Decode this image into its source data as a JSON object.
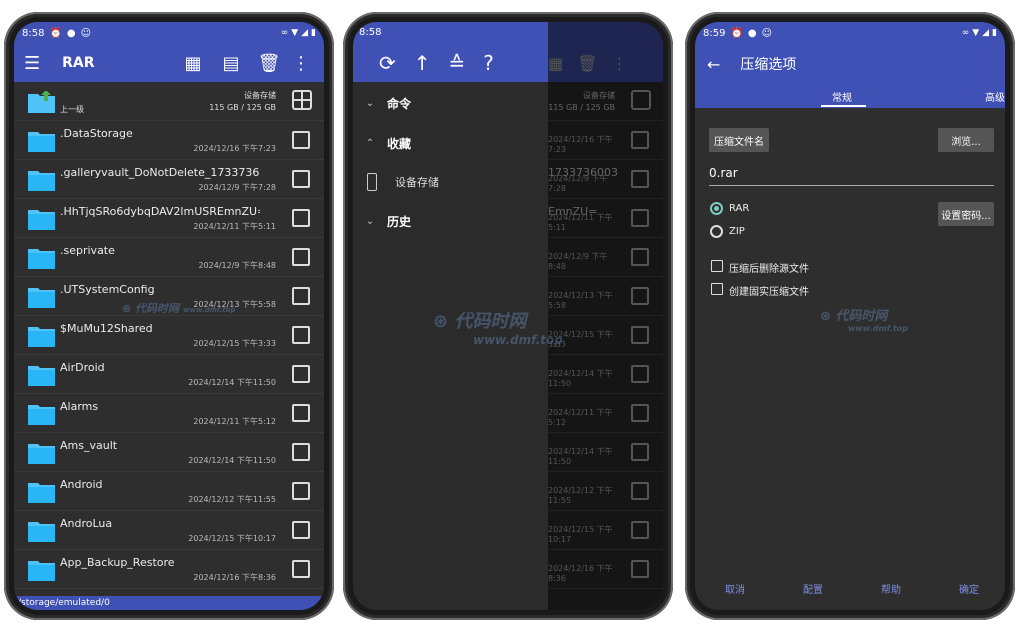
{
  "phone1": {
    "status": {
      "time": "8:58"
    },
    "toolbar": {
      "title": "RAR"
    },
    "up_row": {
      "label": "上一级",
      "storage_title": "设备存储",
      "storage_size": "115 GB / 125 GB"
    },
    "files": [
      {
        "name": ".DataStorage",
        "date": "2024/12/16 下午7:23"
      },
      {
        "name": ".galleryvault_DoNotDelete_1733736003",
        "date": "2024/12/9 下午7:28"
      },
      {
        "name": ".HhTjqSRo6dybqDAV2lmUSREmnZU=",
        "date": "2024/12/11 下午5:11"
      },
      {
        "name": ".seprivate",
        "date": "2024/12/9 下午8:48"
      },
      {
        "name": ".UTSystemConfig",
        "date": "2024/12/13 下午5:58"
      },
      {
        "name": "$MuMu12Shared",
        "date": "2024/12/15 下午3:33"
      },
      {
        "name": "AirDroid",
        "date": "2024/12/14 下午11:50"
      },
      {
        "name": "Alarms",
        "date": "2024/12/11 下午5:12"
      },
      {
        "name": "Ams_vault",
        "date": "2024/12/14 下午11:50"
      },
      {
        "name": "Android",
        "date": "2024/12/12 下午11:55"
      },
      {
        "name": "AndroLua",
        "date": "2024/12/15 下午10:17"
      },
      {
        "name": "App_Backup_Restore",
        "date": "2024/12/16 下午8:36"
      }
    ],
    "path": "/storage/emulated/0"
  },
  "phone2": {
    "status": {
      "time": "8:58"
    },
    "drawer": {
      "commands": "命令",
      "favorites": "收藏",
      "device_storage": "设备存储",
      "history": "历史"
    },
    "bg": {
      "storage_title": "设备存储",
      "storage_size": "115 GB / 125 GB",
      "names": [
        "",
        "1733736003",
        "EmnZU=",
        "",
        "",
        "",
        "",
        "",
        "",
        "",
        "",
        ""
      ],
      "dates": [
        "2024/12/16 下午7:23",
        "2024/12/9 下午7:28",
        "2024/12/11 下午5:11",
        "2024/12/9 下午8:48",
        "2024/12/13 下午5:58",
        "2024/12/15 下午3:33",
        "2024/12/14 下午11:50",
        "2024/12/11 下午5:12",
        "2024/12/14 下午11:50",
        "2024/12/12 下午11:55",
        "2024/12/15 下午10:17",
        "2024/12/16 下午8:36"
      ]
    }
  },
  "phone3": {
    "status": {
      "time": "8:59"
    },
    "title": "压缩选项",
    "tabs": {
      "general": "常规",
      "advanced": "高级"
    },
    "archive_name_btn": "压缩文件名",
    "browse_btn": "浏览...",
    "archive_name": "0.rar",
    "format_rar": "RAR",
    "format_zip": "ZIP",
    "set_password_btn": "设置密码...",
    "delete_after": "压缩后删除源文件",
    "solid": "创建固实压缩文件",
    "footer": {
      "cancel": "取消",
      "profiles": "配置",
      "help": "帮助",
      "ok": "确定"
    }
  },
  "watermark": {
    "text": "代码时网",
    "url": "www.dmf.top"
  },
  "colors": {
    "accent": "#3f51b5",
    "folder": "#4fc3f7",
    "radio_on": "#80cbc4"
  }
}
